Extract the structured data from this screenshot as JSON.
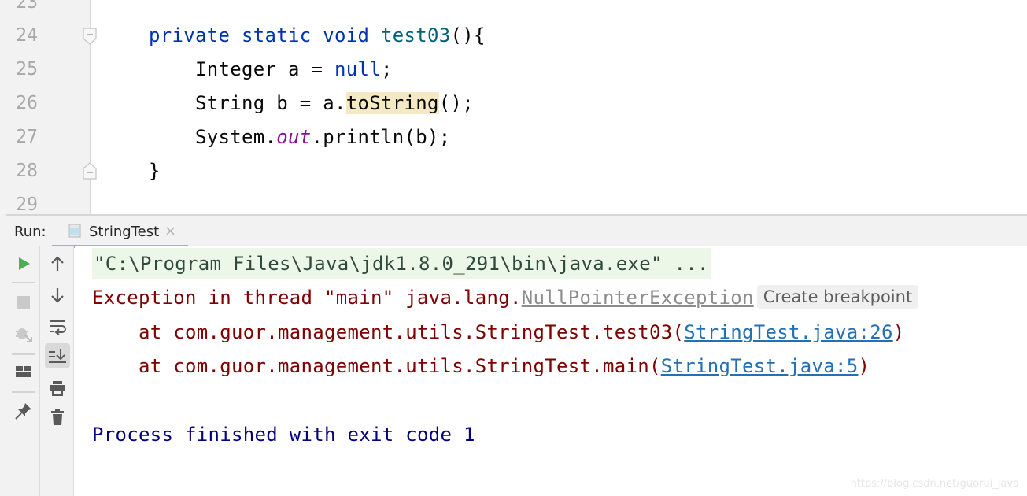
{
  "editor": {
    "lines": [
      {
        "num": "23"
      },
      {
        "num": "24",
        "kw1": "private",
        "kw2": "static",
        "kw3": "void",
        "method": "test03",
        "rest": "(){"
      },
      {
        "num": "25",
        "text1": "    Integer a = ",
        "kw": "null",
        "text2": ";"
      },
      {
        "num": "26",
        "text1": "    String b = a.",
        "highlight": "toString",
        "text2": "();"
      },
      {
        "num": "27",
        "text1": "    System.",
        "field": "out",
        "text2": ".println(b);"
      },
      {
        "num": "28",
        "text1": "}"
      },
      {
        "num": "29"
      }
    ]
  },
  "run_panel": {
    "label": "Run:",
    "tab": {
      "label": "StringTest",
      "close": "×"
    },
    "toolbar_left": [
      "rerun-icon",
      "stop-icon",
      "debug-disabled-icon",
      "layout-icon",
      "pin-icon"
    ],
    "toolbar_right": [
      "up-arrow-icon",
      "down-arrow-icon",
      "soft-wrap-icon",
      "scroll-to-end-icon",
      "print-icon",
      "trash-icon"
    ]
  },
  "console": {
    "command": "\"C:\\Program Files\\Java\\jdk1.8.0_291\\bin\\java.exe\" ...",
    "exception_prefix": "Exception in thread \"main\" java.lang.",
    "exception_class": "NullPointerException",
    "create_breakpoint": "Create breakpoint",
    "stack": [
      {
        "prefix": "    at com.guor.management.utils.StringTest.test03(",
        "link": "StringTest.java:26",
        "suffix": ")"
      },
      {
        "prefix": "    at com.guor.management.utils.StringTest.main(",
        "link": "StringTest.java:5",
        "suffix": ")"
      }
    ],
    "finished": "Process finished with exit code 1"
  },
  "watermark": "https://blog.csdn.net/guorui_java",
  "colors": {
    "keyword": "#0033b3",
    "method": "#00627a",
    "error": "#7f0000",
    "link": "#2470b3",
    "finished": "#000080",
    "run_green": "#4caf50"
  }
}
